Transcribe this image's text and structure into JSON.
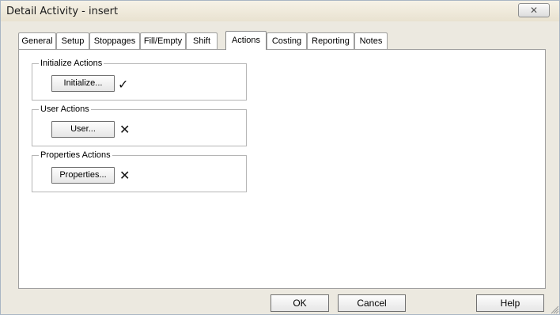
{
  "window": {
    "title": "Detail Activity - insert",
    "close_glyph": "✕"
  },
  "tabs": [
    {
      "label": "General",
      "active": false
    },
    {
      "label": "Setup",
      "active": false
    },
    {
      "label": "Stoppages",
      "active": false
    },
    {
      "label": "Fill/Empty",
      "active": false
    },
    {
      "label": "Shift",
      "active": false
    },
    {
      "label": "Actions",
      "active": true
    },
    {
      "label": "Costing",
      "active": false
    },
    {
      "label": "Reporting",
      "active": false
    },
    {
      "label": "Notes",
      "active": false
    }
  ],
  "groups": {
    "initialize": {
      "legend": "Initialize Actions",
      "button": "Initialize...",
      "status": "✓",
      "status_icon": "checkmark-icon"
    },
    "user": {
      "legend": "User Actions",
      "button": "User...",
      "status": "✕",
      "status_icon": "cross-icon"
    },
    "properties": {
      "legend": "Properties Actions",
      "button": "Properties...",
      "status": "✕",
      "status_icon": "cross-icon"
    }
  },
  "footer": {
    "ok_label": "OK",
    "cancel_label": "Cancel",
    "help_label": "Help"
  },
  "colors": {
    "window_background": "#ece9e0",
    "panel_background": "#ffffff"
  }
}
